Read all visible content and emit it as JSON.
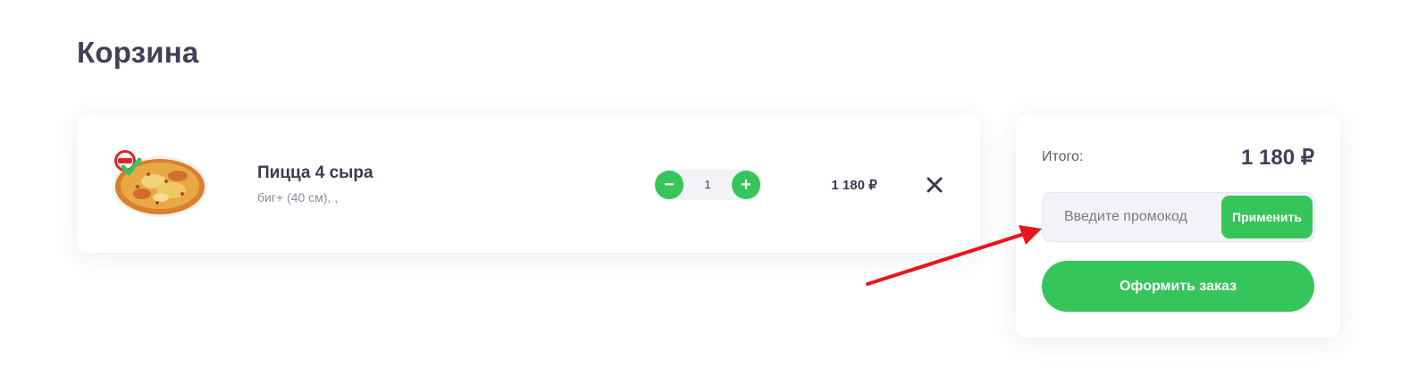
{
  "page": {
    "title": "Корзина"
  },
  "cart": {
    "items": [
      {
        "name": "Пицца 4 сыра",
        "description": "биг+ (40 см), ,",
        "quantity": "1",
        "price": "1 180 ₽",
        "minus_label": "−",
        "plus_label": "+",
        "remove_icon": "close-icon",
        "image_icon": "pizza-photo"
      }
    ]
  },
  "summary": {
    "total_label": "Итого:",
    "total_value": "1 180 ₽",
    "promo_placeholder": "Введите промокод",
    "promo_value": "",
    "apply_label": "Применить",
    "checkout_label": "Оформить заказ"
  },
  "colors": {
    "accent": "#36c55a",
    "text": "#3b3b4f",
    "muted": "#8c8c9e",
    "annotation": "#e8141b"
  }
}
